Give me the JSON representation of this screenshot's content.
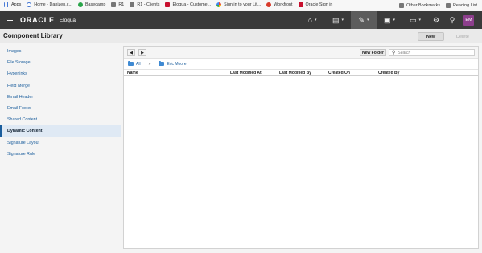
{
  "bookmarks": {
    "items": [
      {
        "label": "Apps",
        "icon": "apps-grid-icon"
      },
      {
        "label": "Home - Danizen.c...",
        "icon": "globe-icon"
      },
      {
        "label": "Basecamp",
        "icon": "basecamp-icon"
      },
      {
        "label": "R1",
        "icon": "folder-icon"
      },
      {
        "label": "R1 - Clients",
        "icon": "folder-icon"
      },
      {
        "label": "Eloqua - Custome...",
        "icon": "oracle-icon"
      },
      {
        "label": "Sign in to your Lit...",
        "icon": "google-icon"
      },
      {
        "label": "Workfront",
        "icon": "workfront-icon"
      },
      {
        "label": "Oracle Sign in",
        "icon": "oracle-icon"
      }
    ],
    "other": "Other Bookmarks",
    "reading": "Reading List"
  },
  "header": {
    "brand": "ORACLE",
    "product": "Eloqua",
    "user_initials": "EM"
  },
  "page": {
    "title": "Component Library",
    "new_label": "New",
    "delete_label": "Delete"
  },
  "sidebar": {
    "items": [
      {
        "label": "Images"
      },
      {
        "label": "File Storage"
      },
      {
        "label": "Hyperlinks"
      },
      {
        "label": "Field Merge"
      },
      {
        "label": "Email Header"
      },
      {
        "label": "Email Footer"
      },
      {
        "label": "Shared Content"
      },
      {
        "label": "Dynamic Content",
        "selected": true
      },
      {
        "label": "Signature Layout"
      },
      {
        "label": "Signature Rule"
      }
    ]
  },
  "panel": {
    "back_glyph": "◀",
    "forward_glyph": "▶",
    "new_folder_label": "New Folder",
    "search_placeholder": "Search",
    "breadcrumb": [
      "All",
      "Eric Moore"
    ],
    "breadcrumb_sep": "»",
    "columns": [
      "Name",
      "Last Modified At",
      "Last Modified By",
      "Created On",
      "Created By"
    ]
  },
  "colors": {
    "topbar": "#3a3a3a",
    "link": "#1a5d9c",
    "avatar": "#8c3e8c"
  }
}
